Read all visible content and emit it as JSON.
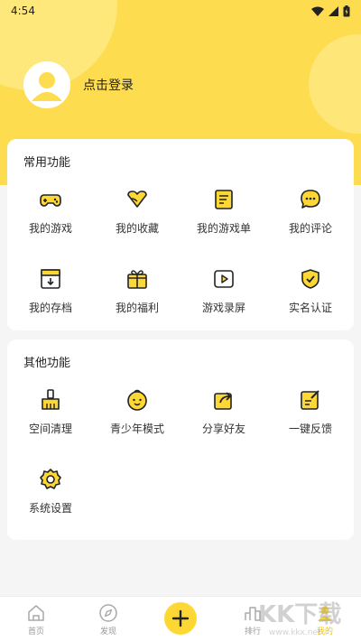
{
  "status_bar": {
    "time": "4:54"
  },
  "profile": {
    "login_label": "点击登录"
  },
  "common": {
    "title": "常用功能",
    "items": [
      {
        "label": "我的游戏",
        "icon": "gamepad-icon"
      },
      {
        "label": "我的收藏",
        "icon": "heart-icon"
      },
      {
        "label": "我的游戏单",
        "icon": "list-icon"
      },
      {
        "label": "我的评论",
        "icon": "comment-icon"
      },
      {
        "label": "我的存档",
        "icon": "archive-icon"
      },
      {
        "label": "我的福利",
        "icon": "gift-icon"
      },
      {
        "label": "游戏录屏",
        "icon": "play-video-icon"
      },
      {
        "label": "实名认证",
        "icon": "shield-check-icon"
      }
    ]
  },
  "other": {
    "title": "其他功能",
    "items": [
      {
        "label": "空间清理",
        "icon": "broom-icon"
      },
      {
        "label": "青少年模式",
        "icon": "child-face-icon"
      },
      {
        "label": "分享好友",
        "icon": "share-icon"
      },
      {
        "label": "一键反馈",
        "icon": "feedback-icon"
      },
      {
        "label": "系统设置",
        "icon": "gear-icon"
      }
    ]
  },
  "tabbar": {
    "items": [
      {
        "label": "首页",
        "icon": "home-icon"
      },
      {
        "label": "发现",
        "icon": "compass-icon"
      },
      {
        "label": "",
        "icon": "plus-icon"
      },
      {
        "label": "排行",
        "icon": "ranking-icon"
      },
      {
        "label": "我的",
        "icon": "profile-icon",
        "active": true
      }
    ]
  },
  "watermark": {
    "text": "KK下载",
    "url": "www.kkx.net"
  },
  "colors": {
    "accent": "#fddd4f",
    "icon_dark": "#222222",
    "icon_fill": "#fdd835"
  }
}
